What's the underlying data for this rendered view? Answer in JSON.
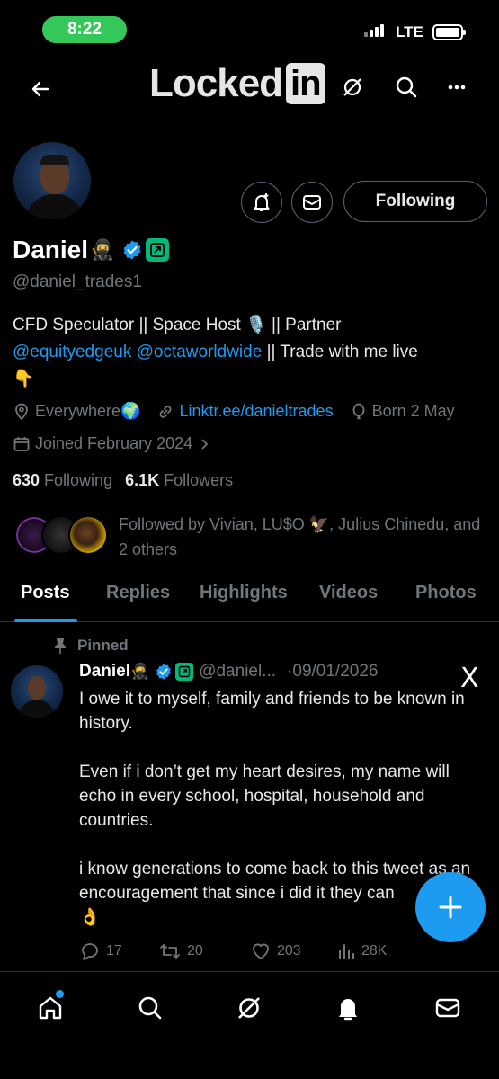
{
  "status_bar": {
    "time": "8:22",
    "network": "LTE"
  },
  "header": {
    "logo_text": "Locked",
    "logo_badge": "in"
  },
  "profile": {
    "display_name": "Daniel",
    "name_emoji": "🥷",
    "handle": "@daniel_trades1",
    "bio_line1": "CFD Speculator || Space Host 🎙️ || Partner",
    "bio_mention1": "@equityedgeuk",
    "bio_mention2": "@octaworldwide",
    "bio_tail": " || Trade with me live",
    "bio_emoji": "👇",
    "location": "Everywhere🌍",
    "website": "Linktr.ee/danieltrades",
    "birthday": "Born 2 May",
    "joined": "Joined February 2024",
    "following_count": "630",
    "following_label": "Following",
    "followers_count": "6.1K",
    "followers_label": "Followers",
    "followed_by": "Followed by Vivian, LU$O 🦅, Julius Chinedu, and 2 others",
    "follow_button": "Following"
  },
  "tabs": [
    "Posts",
    "Replies",
    "Highlights",
    "Videos",
    "Photos"
  ],
  "active_tab": "Posts",
  "tweet": {
    "pinned_label": "Pinned",
    "name": "Daniel",
    "name_emoji": "🥷",
    "handle": "@daniel...",
    "date": "·09/01/2026",
    "text": "I owe it to myself, family and friends to be known in history.\n\nEven if i don’t get my heart desires, my name will echo in every school, hospital, household and countries.\n\ni know generations to come back to this tweet as an encouragement that since i did it they can\n👌",
    "replies": "17",
    "reposts": "20",
    "likes": "203",
    "views": "28K",
    "source_icon": "X"
  },
  "colors": {
    "accent": "#1d9bf0",
    "muted": "#71767b",
    "status_pill": "#34c759",
    "badge_green": "#00ba7c"
  },
  "icons": [
    "back-arrow-icon",
    "grok-icon",
    "search-icon",
    "more-icon",
    "notification-bell-icon",
    "message-icon",
    "verified-icon",
    "location-icon",
    "link-icon",
    "balloon-icon",
    "calendar-icon",
    "pin-icon",
    "reply-icon",
    "repost-icon",
    "like-icon",
    "views-icon",
    "compose-plus-icon",
    "home-icon",
    "bell-icon",
    "mail-icon"
  ]
}
